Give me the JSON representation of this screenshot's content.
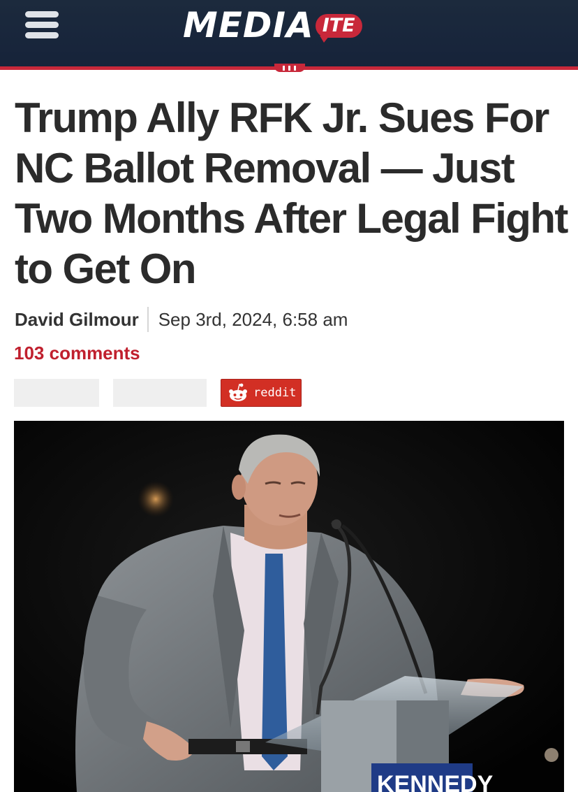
{
  "header": {
    "logo_main": "MEDIA",
    "logo_bubble": "ITE",
    "menu_icon": "hamburger-menu-icon",
    "colors": {
      "bar": "#1c2a3d",
      "accent": "#c8283a"
    }
  },
  "article": {
    "headline": "Trump Ally RFK Jr. Sues For NC Ballot Removal — Just Two Months After Legal Fight to Get On",
    "author": "David Gilmour",
    "date": "Sep 3rd, 2024, 6:58 am",
    "comments": "103 comments"
  },
  "share": {
    "reddit_label": "reddit",
    "reddit_icon": "reddit-alien-icon"
  },
  "photo": {
    "podium_sign": "KENNEDY"
  }
}
